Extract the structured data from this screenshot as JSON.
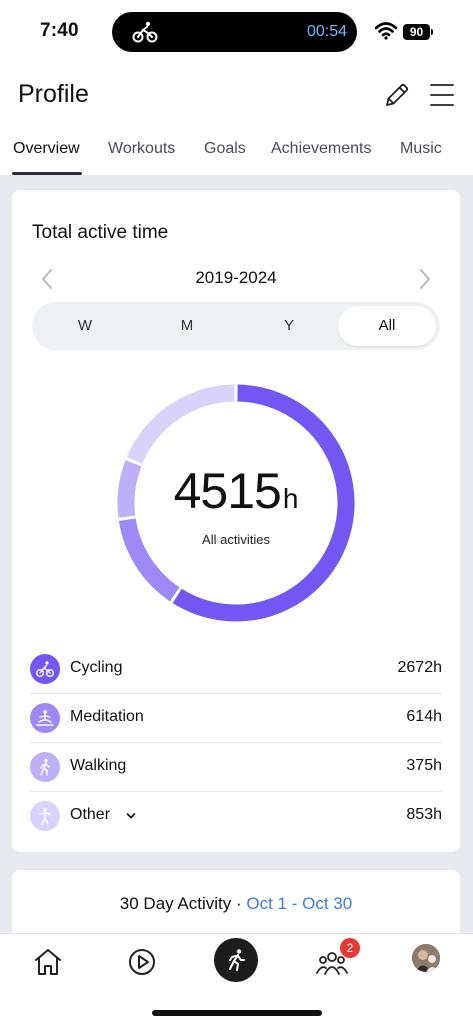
{
  "status_bar": {
    "time": "7:40",
    "timer": "00:54",
    "battery": "90"
  },
  "header": {
    "title": "Profile",
    "icons": [
      "edit-icon",
      "menu-icon"
    ]
  },
  "tabs": [
    {
      "label": "Overview",
      "active": true
    },
    {
      "label": "Workouts",
      "active": false
    },
    {
      "label": "Goals",
      "active": false
    },
    {
      "label": "Achievements",
      "active": false
    },
    {
      "label": "Music",
      "active": false
    }
  ],
  "card": {
    "title": "Total active time",
    "year_range": "2019-2024",
    "segments": [
      {
        "label": "W",
        "active": false
      },
      {
        "label": "M",
        "active": false
      },
      {
        "label": "Y",
        "active": false
      },
      {
        "label": "All",
        "active": true
      }
    ],
    "total": "4515",
    "total_unit": "h",
    "total_sub": "All activities"
  },
  "chart_data": {
    "type": "pie",
    "categories": [
      "Cycling",
      "Meditation",
      "Walking",
      "Other"
    ],
    "values": [
      2672,
      614,
      375,
      853
    ],
    "unit": "h",
    "colors": [
      "#7357f2",
      "#9e8af6",
      "#bdb0f9",
      "#d9d3fc"
    ],
    "legend": [
      {
        "label": "Cycling",
        "value": "2672h",
        "icon": "cycling-icon"
      },
      {
        "label": "Meditation",
        "value": "614h",
        "icon": "meditation-icon"
      },
      {
        "label": "Walking",
        "value": "375h",
        "icon": "walking-icon"
      },
      {
        "label": "Other",
        "value": "853h",
        "icon": "person-icon"
      }
    ]
  },
  "activity_card": {
    "title": "30 Day Activity",
    "separator": " · ",
    "range": "Oct 1 - Oct 30"
  },
  "bottom_nav": {
    "items": [
      "home-icon",
      "play-icon",
      "record-icon",
      "community-icon",
      "avatar"
    ],
    "badge": "2"
  }
}
